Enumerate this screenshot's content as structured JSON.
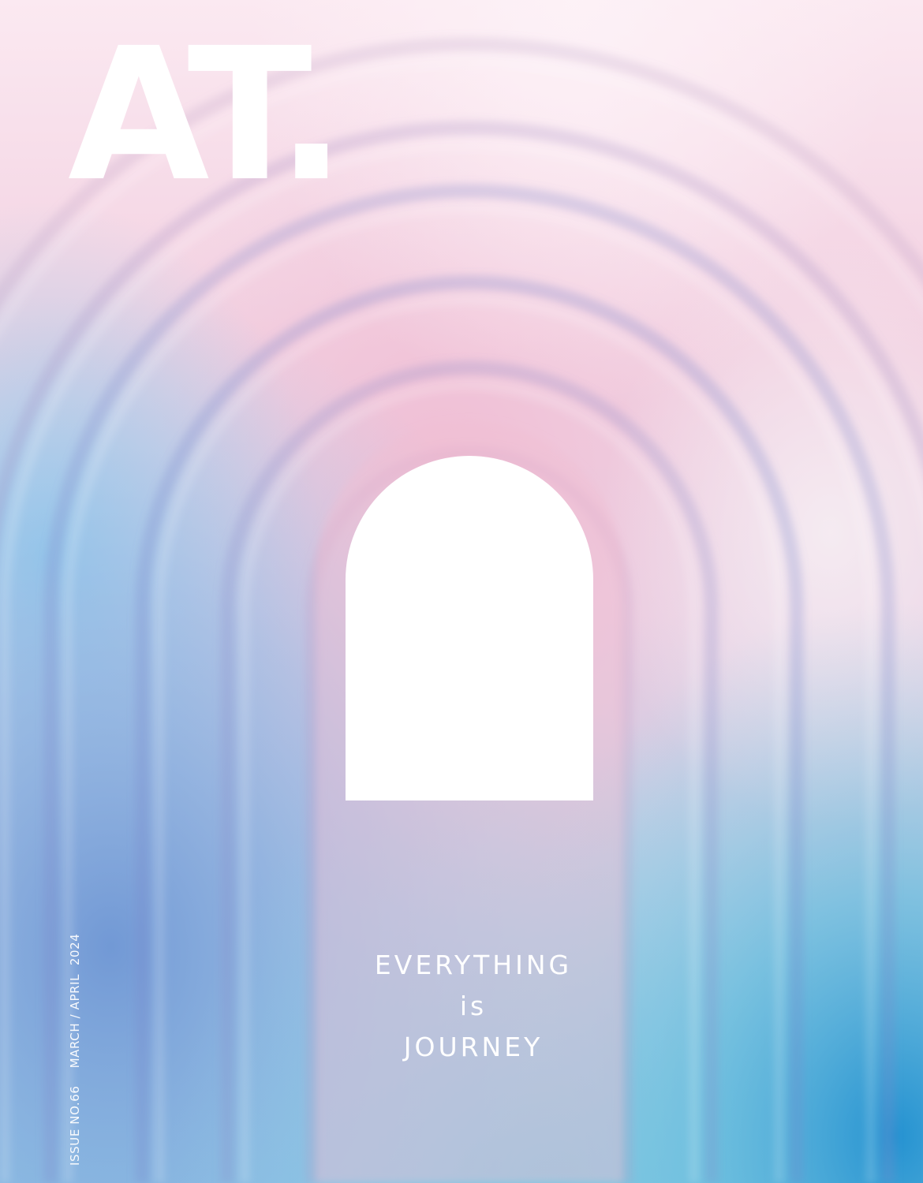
{
  "cover": {
    "masthead": "AT.",
    "headline": {
      "line1": "EVERYTHING",
      "line2": "is",
      "line3": "JOURNEY"
    },
    "issue": "ISSUE NO.66",
    "date": "MARCH / APRIL  2024"
  },
  "colors": {
    "pink": "#f2c3d7",
    "blush": "#f6e2ec",
    "blue": "#6aa6d8",
    "deep_blue": "#5c77bf",
    "cyan": "#55b7d9",
    "window": "#ffffff",
    "text": "#ffffff"
  }
}
